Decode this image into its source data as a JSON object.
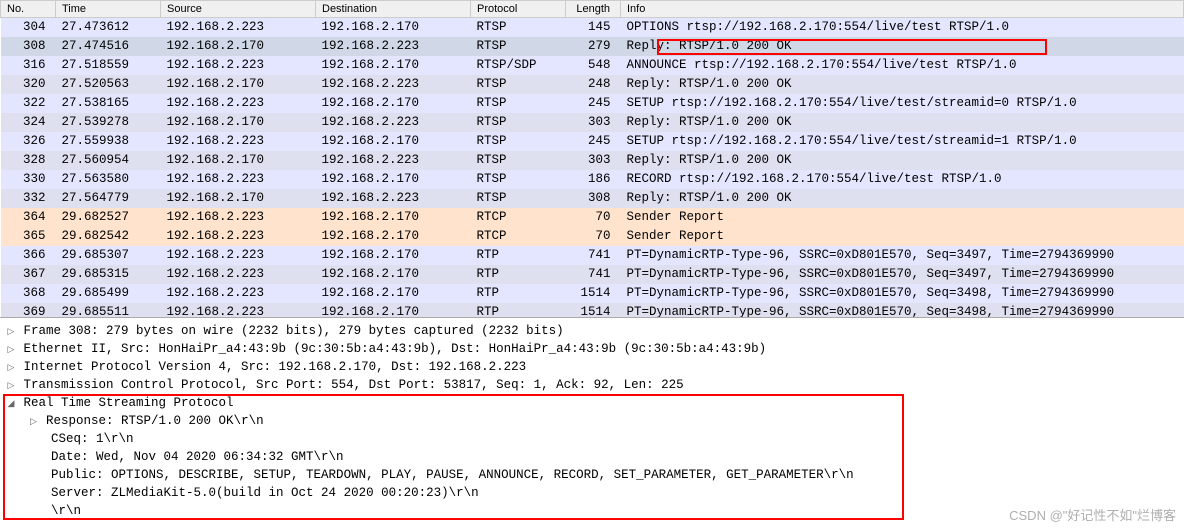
{
  "columns": {
    "no": "No.",
    "time": "Time",
    "source": "Source",
    "destination": "Destination",
    "protocol": "Protocol",
    "length": "Length",
    "info": "Info"
  },
  "packets": [
    {
      "no": "304",
      "time": "27.473612",
      "src": "192.168.2.223",
      "dst": "192.168.2.170",
      "proto": "RTSP",
      "len": "145",
      "info": "OPTIONS rtsp://192.168.2.170:554/live/test RTSP/1.0",
      "cls": "c-e4e6ff"
    },
    {
      "no": "308",
      "time": "27.474516",
      "src": "192.168.2.170",
      "dst": "192.168.2.223",
      "proto": "RTSP",
      "len": "279",
      "info": "Reply: RTSP/1.0 200 OK",
      "cls": "c-e4e6ff selected"
    },
    {
      "no": "316",
      "time": "27.518559",
      "src": "192.168.2.223",
      "dst": "192.168.2.170",
      "proto": "RTSP/SDP",
      "len": "548",
      "info": "ANNOUNCE rtsp://192.168.2.170:554/live/test RTSP/1.0",
      "cls": "c-e4e6ff"
    },
    {
      "no": "320",
      "time": "27.520563",
      "src": "192.168.2.170",
      "dst": "192.168.2.223",
      "proto": "RTSP",
      "len": "248",
      "info": "Reply: RTSP/1.0 200 OK",
      "cls": "c-dedfef"
    },
    {
      "no": "322",
      "time": "27.538165",
      "src": "192.168.2.223",
      "dst": "192.168.2.170",
      "proto": "RTSP",
      "len": "245",
      "info": "SETUP rtsp://192.168.2.170:554/live/test/streamid=0 RTSP/1.0",
      "cls": "c-e4e6ff"
    },
    {
      "no": "324",
      "time": "27.539278",
      "src": "192.168.2.170",
      "dst": "192.168.2.223",
      "proto": "RTSP",
      "len": "303",
      "info": "Reply: RTSP/1.0 200 OK",
      "cls": "c-dedfef"
    },
    {
      "no": "326",
      "time": "27.559938",
      "src": "192.168.2.223",
      "dst": "192.168.2.170",
      "proto": "RTSP",
      "len": "245",
      "info": "SETUP rtsp://192.168.2.170:554/live/test/streamid=1 RTSP/1.0",
      "cls": "c-e4e6ff"
    },
    {
      "no": "328",
      "time": "27.560954",
      "src": "192.168.2.170",
      "dst": "192.168.2.223",
      "proto": "RTSP",
      "len": "303",
      "info": "Reply: RTSP/1.0 200 OK",
      "cls": "c-dedfef"
    },
    {
      "no": "330",
      "time": "27.563580",
      "src": "192.168.2.223",
      "dst": "192.168.2.170",
      "proto": "RTSP",
      "len": "186",
      "info": "RECORD rtsp://192.168.2.170:554/live/test RTSP/1.0",
      "cls": "c-e4e6ff"
    },
    {
      "no": "332",
      "time": "27.564779",
      "src": "192.168.2.170",
      "dst": "192.168.2.223",
      "proto": "RTSP",
      "len": "308",
      "info": "Reply: RTSP/1.0 200 OK",
      "cls": "c-dedfef"
    },
    {
      "no": "364",
      "time": "29.682527",
      "src": "192.168.2.223",
      "dst": "192.168.2.170",
      "proto": "RTCP",
      "len": "70",
      "info": "Sender Report",
      "cls": "c-ffe3cd"
    },
    {
      "no": "365",
      "time": "29.682542",
      "src": "192.168.2.223",
      "dst": "192.168.2.170",
      "proto": "RTCP",
      "len": "70",
      "info": "Sender Report",
      "cls": "c-ffe3cd"
    },
    {
      "no": "366",
      "time": "29.685307",
      "src": "192.168.2.223",
      "dst": "192.168.2.170",
      "proto": "RTP",
      "len": "741",
      "info": "PT=DynamicRTP-Type-96, SSRC=0xD801E570, Seq=3497, Time=2794369990",
      "cls": "c-e4e6ff"
    },
    {
      "no": "367",
      "time": "29.685315",
      "src": "192.168.2.223",
      "dst": "192.168.2.170",
      "proto": "RTP",
      "len": "741",
      "info": "PT=DynamicRTP-Type-96, SSRC=0xD801E570, Seq=3497, Time=2794369990",
      "cls": "c-dedfef"
    },
    {
      "no": "368",
      "time": "29.685499",
      "src": "192.168.2.223",
      "dst": "192.168.2.170",
      "proto": "RTP",
      "len": "1514",
      "info": "PT=DynamicRTP-Type-96, SSRC=0xD801E570, Seq=3498, Time=2794369990",
      "cls": "c-e4e6ff"
    },
    {
      "no": "369",
      "time": "29.685511",
      "src": "192.168.2.223",
      "dst": "192.168.2.170",
      "proto": "RTP",
      "len": "1514",
      "info": "PT=DynamicRTP-Type-96, SSRC=0xD801E570, Seq=3498, Time=2794369990",
      "cls": "c-dedfef"
    }
  ],
  "detail": {
    "frame": "Frame 308: 279 bytes on wire (2232 bits), 279 bytes captured (2232 bits)",
    "eth": "Ethernet II, Src: HonHaiPr_a4:43:9b (9c:30:5b:a4:43:9b), Dst: HonHaiPr_a4:43:9b (9c:30:5b:a4:43:9b)",
    "ip": "Internet Protocol Version 4, Src: 192.168.2.170, Dst: 192.168.2.223",
    "tcp": "Transmission Control Protocol, Src Port: 554, Dst Port: 53817, Seq: 1, Ack: 92, Len: 225",
    "rtsp": "Real Time Streaming Protocol",
    "rtsp_children": {
      "response": "Response: RTSP/1.0 200 OK\\r\\n",
      "cseq": "CSeq: 1\\r\\n",
      "date": "Date: Wed, Nov 04 2020 06:34:32 GMT\\r\\n",
      "public": "Public: OPTIONS, DESCRIBE, SETUP, TEARDOWN, PLAY, PAUSE, ANNOUNCE, RECORD, SET_PARAMETER, GET_PARAMETER\\r\\n",
      "server": "Server: ZLMediaKit-5.0(build in Oct 24 2020 00:20:23)\\r\\n",
      "blank": "\\r\\n"
    }
  },
  "watermark": "CSDN @\"好记性不如\"烂博客"
}
